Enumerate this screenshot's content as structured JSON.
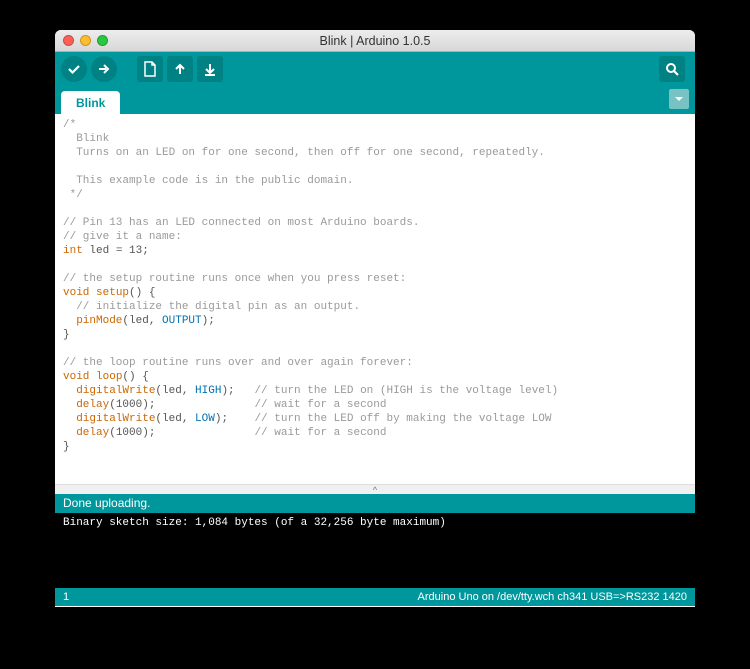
{
  "window": {
    "title": "Blink | Arduino 1.0.5"
  },
  "tab": {
    "name": "Blink"
  },
  "toolbar": {
    "verify": "verify",
    "upload": "upload",
    "new": "new",
    "open": "open",
    "save": "save",
    "serial": "serial-monitor"
  },
  "code": {
    "l1": "/*",
    "l2": "  Blink",
    "l3": "  Turns on an LED on for one second, then off for one second, repeatedly.",
    "l4": " ",
    "l5": "  This example code is in the public domain.",
    "l6": " */",
    "l7": " ",
    "l8": "// Pin 13 has an LED connected on most Arduino boards.",
    "l9": "// give it a name:",
    "l10a": "int",
    "l10b": " led = 13;",
    "l11": "",
    "l12": "// the setup routine runs once when you press reset:",
    "l13a": "void",
    "l13b": " ",
    "l13c": "setup",
    "l13d": "() {",
    "l14": "  // initialize the digital pin as an output.",
    "l15a": "  ",
    "l15b": "pinMode",
    "l15c": "(led, ",
    "l15d": "OUTPUT",
    "l15e": ");",
    "l16": "}",
    "l17": "",
    "l18": "// the loop routine runs over and over again forever:",
    "l19a": "void",
    "l19b": " ",
    "l19c": "loop",
    "l19d": "() {",
    "l20a": "  ",
    "l20b": "digitalWrite",
    "l20c": "(led, ",
    "l20d": "HIGH",
    "l20e": ");   ",
    "l20f": "// turn the LED on (HIGH is the voltage level)",
    "l21a": "  ",
    "l21b": "delay",
    "l21c": "(1000);               ",
    "l21d": "// wait for a second",
    "l22a": "  ",
    "l22b": "digitalWrite",
    "l22c": "(led, ",
    "l22d": "LOW",
    "l22e": ");    ",
    "l22f": "// turn the LED off by making the voltage LOW",
    "l23a": "  ",
    "l23b": "delay",
    "l23c": "(1000);               ",
    "l23d": "// wait for a second",
    "l24": "}"
  },
  "status": {
    "message": "Done uploading."
  },
  "console": {
    "line1": "Binary sketch size: 1,084 bytes (of a 32,256 byte maximum)"
  },
  "footer": {
    "line": "1",
    "board": "Arduino Uno on /dev/tty.wch ch341 USB=>RS232 1420"
  }
}
